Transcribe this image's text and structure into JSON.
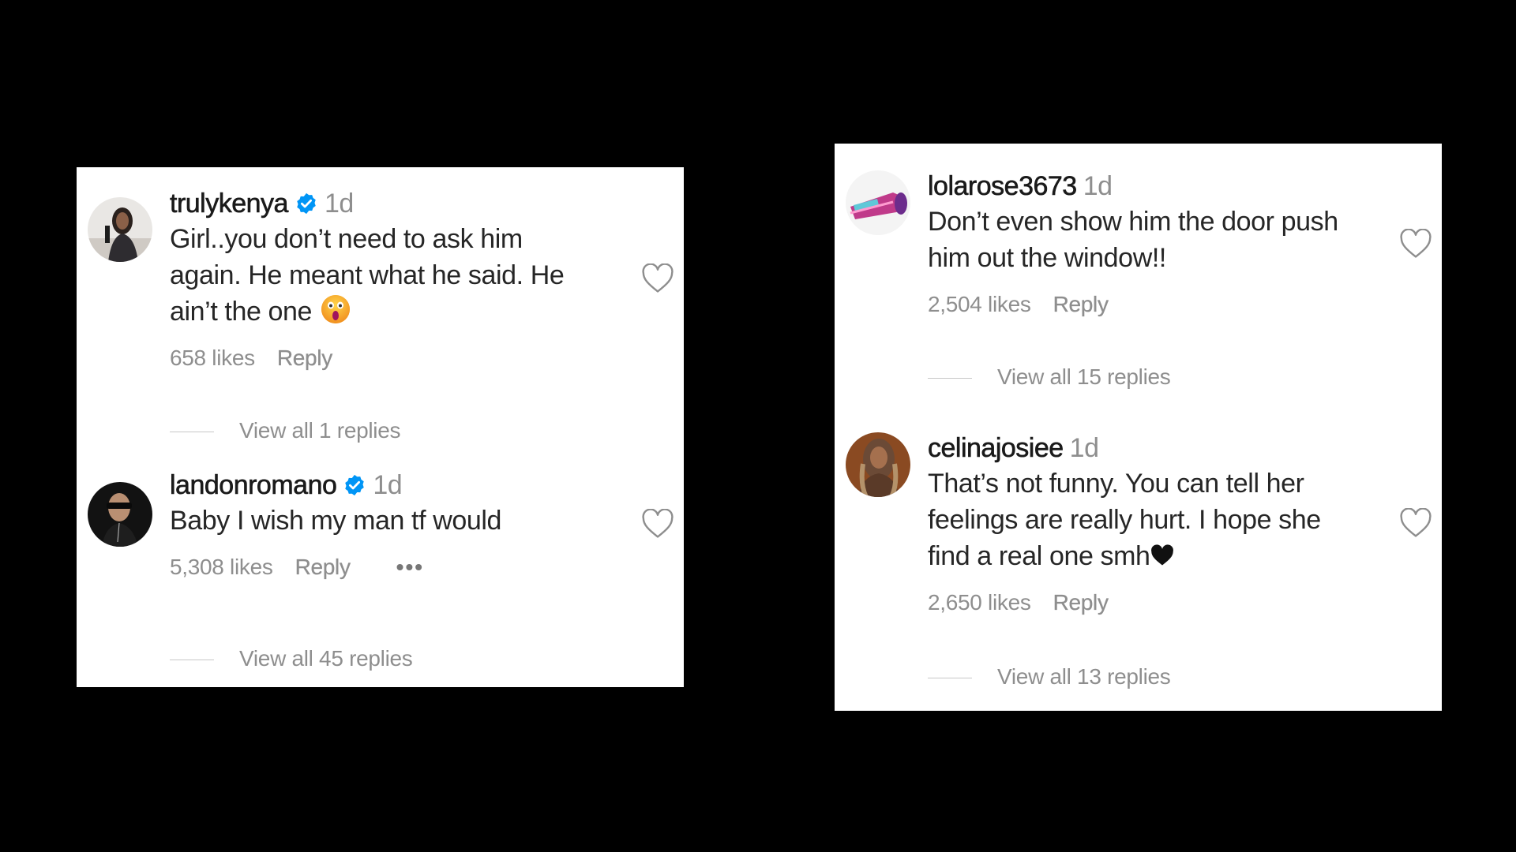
{
  "left_card": {
    "comments": [
      {
        "username": "trulykenya",
        "verified": true,
        "time": "1d",
        "text": "Girl..you don’t need to ask him again. He meant what he said. He ain’t the one",
        "emoji": "astonished-face",
        "likes": "658 likes",
        "reply_label": "Reply",
        "view_replies": "View all 1 replies"
      },
      {
        "username": "landonromano",
        "verified": true,
        "time": "1d",
        "text": "Baby I wish my man tf would",
        "likes": "5,308 likes",
        "reply_label": "Reply",
        "more_label": "•••",
        "view_replies": "View all 45 replies"
      }
    ]
  },
  "right_card": {
    "comments": [
      {
        "username": "lolarose3673",
        "verified": false,
        "time": "1d",
        "text": "Don’t even show him the door push him out the window!!",
        "likes": "2,504 likes",
        "reply_label": "Reply",
        "view_replies": "View all 15 replies"
      },
      {
        "username": "celinajosiee",
        "verified": false,
        "time": "1d",
        "text": "That’s not funny. You can tell her feelings are really hurt. I hope she find a real one smh",
        "emoji": "black-heart",
        "likes": "2,650 likes",
        "reply_label": "Reply",
        "view_replies": "View all 13 replies"
      }
    ]
  },
  "colors": {
    "background": "#000000",
    "card": "#ffffff",
    "verified": "#0095f6",
    "muted": "#8e8e8e",
    "text": "#262626"
  }
}
